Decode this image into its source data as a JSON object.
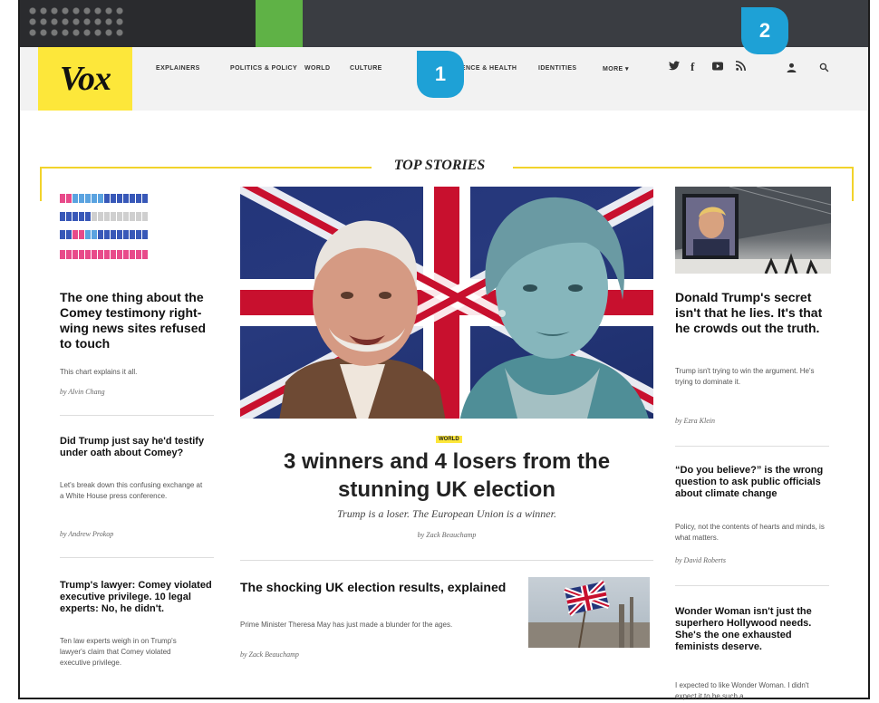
{
  "nav": {
    "logo": "Vox",
    "items": [
      "EXPLAINERS",
      "POLITICS & POLICY",
      "WORLD",
      "CULTURE",
      "SCIENCE & HEALTH",
      "IDENTITIES",
      "MORE ▾"
    ],
    "social": [
      "twitter-icon",
      "facebook-icon",
      "youtube-icon",
      "rss-icon"
    ],
    "utility": [
      "user-icon",
      "search-icon"
    ]
  },
  "callouts": [
    "1",
    "2"
  ],
  "section_title": "TOP STORIES",
  "left": {
    "lead": {
      "headline": "The one thing about the Comey testimony right-wing news sites refused to touch",
      "dek": "This chart explains it all.",
      "byline": "by Alvin Chang"
    },
    "story2": {
      "headline": "Did Trump just say he'd testify under oath about Comey?",
      "dek": "Let's break down this confusing exchange at a White House press conference.",
      "byline": "by Andrew Prokop"
    },
    "story3": {
      "headline": "Trump's lawyer: Comey violated executive privilege. 10 legal experts: No, he didn't.",
      "dek": "Ten law experts weigh in on Trump's lawyer's claim that Comey violated executive privilege."
    }
  },
  "center": {
    "tag": "WORLD",
    "headline": "3 winners and 4 losers from the stunning UK election",
    "dek": "Trump is a loser. The European Union is a winner.",
    "byline": "by Zack Beauchamp",
    "story2": {
      "headline": "The shocking UK election results, explained",
      "dek": "Prime Minister Theresa May has just made a blunder for the ages.",
      "byline": "by Zack Beauchamp"
    }
  },
  "right": {
    "lead": {
      "headline": "Donald Trump's secret isn't that he lies. It's that he crowds out the truth.",
      "dek": "Trump isn't trying to win the argument. He's trying to dominate it.",
      "byline": "by Ezra Klein"
    },
    "story2": {
      "headline": "“Do you believe?” is the wrong question to ask public officials about climate change",
      "dek": "Policy, not the contents of hearts and minds, is what matters.",
      "byline": "by David Roberts"
    },
    "story3": {
      "headline": "Wonder Woman isn't just the superhero Hollywood needs. She's the one exhausted feminists deserve.",
      "dek": "I expected to like Wonder Woman. I didn't expect it to be such a"
    }
  },
  "colors": {
    "brand_yellow": "#fde73a",
    "callout_blue": "#1ea1d6",
    "nav_bg": "#f2f2f2",
    "rule_yellow": "#f2d32b"
  }
}
